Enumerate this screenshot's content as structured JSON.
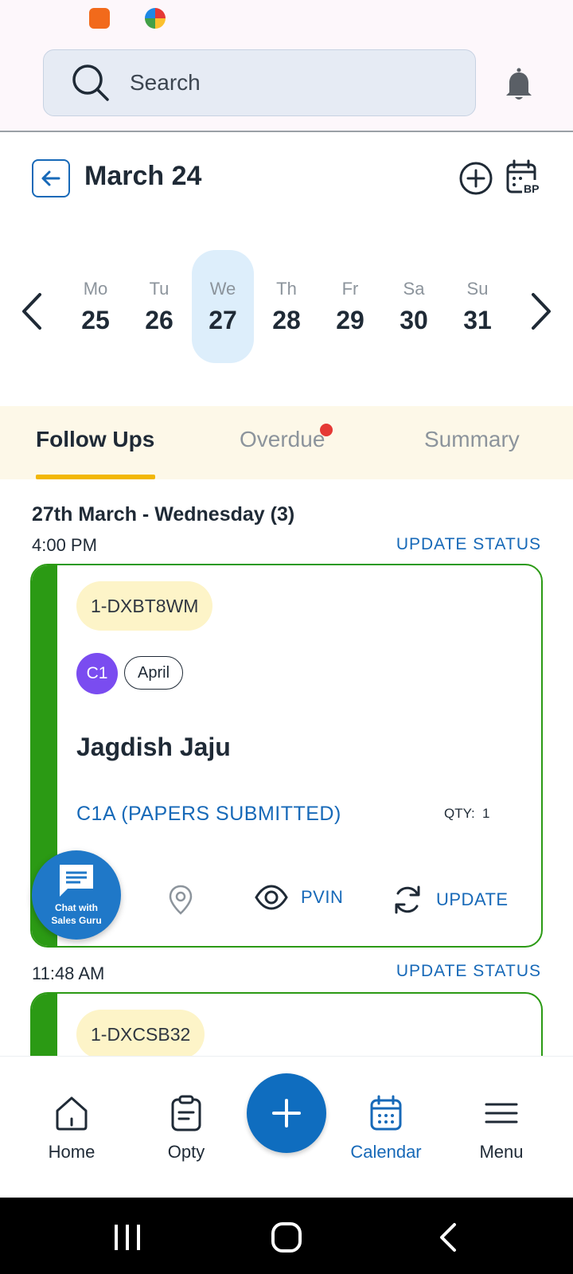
{
  "search": {
    "placeholder": "Search"
  },
  "header": {
    "title": "March 24"
  },
  "week": {
    "days": [
      {
        "name": "Mo",
        "num": "25"
      },
      {
        "name": "Tu",
        "num": "26"
      },
      {
        "name": "We",
        "num": "27",
        "selected": true
      },
      {
        "name": "Th",
        "num": "28"
      },
      {
        "name": "Fr",
        "num": "29"
      },
      {
        "name": "Sa",
        "num": "30"
      },
      {
        "name": "Su",
        "num": "31"
      }
    ]
  },
  "tabs": [
    {
      "label": "Follow Ups",
      "active": true
    },
    {
      "label": "Overdue",
      "has_notification": true
    },
    {
      "label": "Summary"
    }
  ],
  "list": {
    "date_header": "27th March - Wednesday (3)",
    "update_status_label": "UPDATE STATUS",
    "items": [
      {
        "time": "4:00 PM",
        "id": "1-DXBT8WM",
        "avatar": "C1",
        "month": "April",
        "name": "Jagdish Jaju",
        "stage": "C1A (PAPERS SUBMITTED)",
        "qty_label": "QTY:",
        "qty": "1",
        "actions": {
          "pvin": "PVIN",
          "update": "UPDATE"
        }
      },
      {
        "time": "11:48 AM",
        "id": "1-DXCSB32"
      }
    ]
  },
  "chat": {
    "line1": "Chat with",
    "line2": "Sales Guru"
  },
  "bottom_nav": [
    {
      "label": "Home",
      "icon": "home-icon"
    },
    {
      "label": "Opty",
      "icon": "clipboard-icon"
    },
    {
      "label": "Calendar",
      "icon": "calendar-icon",
      "active": true
    },
    {
      "label": "Menu",
      "icon": "menu-icon"
    }
  ],
  "colors": {
    "primary": "#1769b8",
    "card_border": "#2b9a14",
    "tab_underline": "#f2b705",
    "selected_day_bg": "#ddeefb",
    "avatar_bg": "#7a4cf0",
    "notification_dot": "#e53935"
  }
}
